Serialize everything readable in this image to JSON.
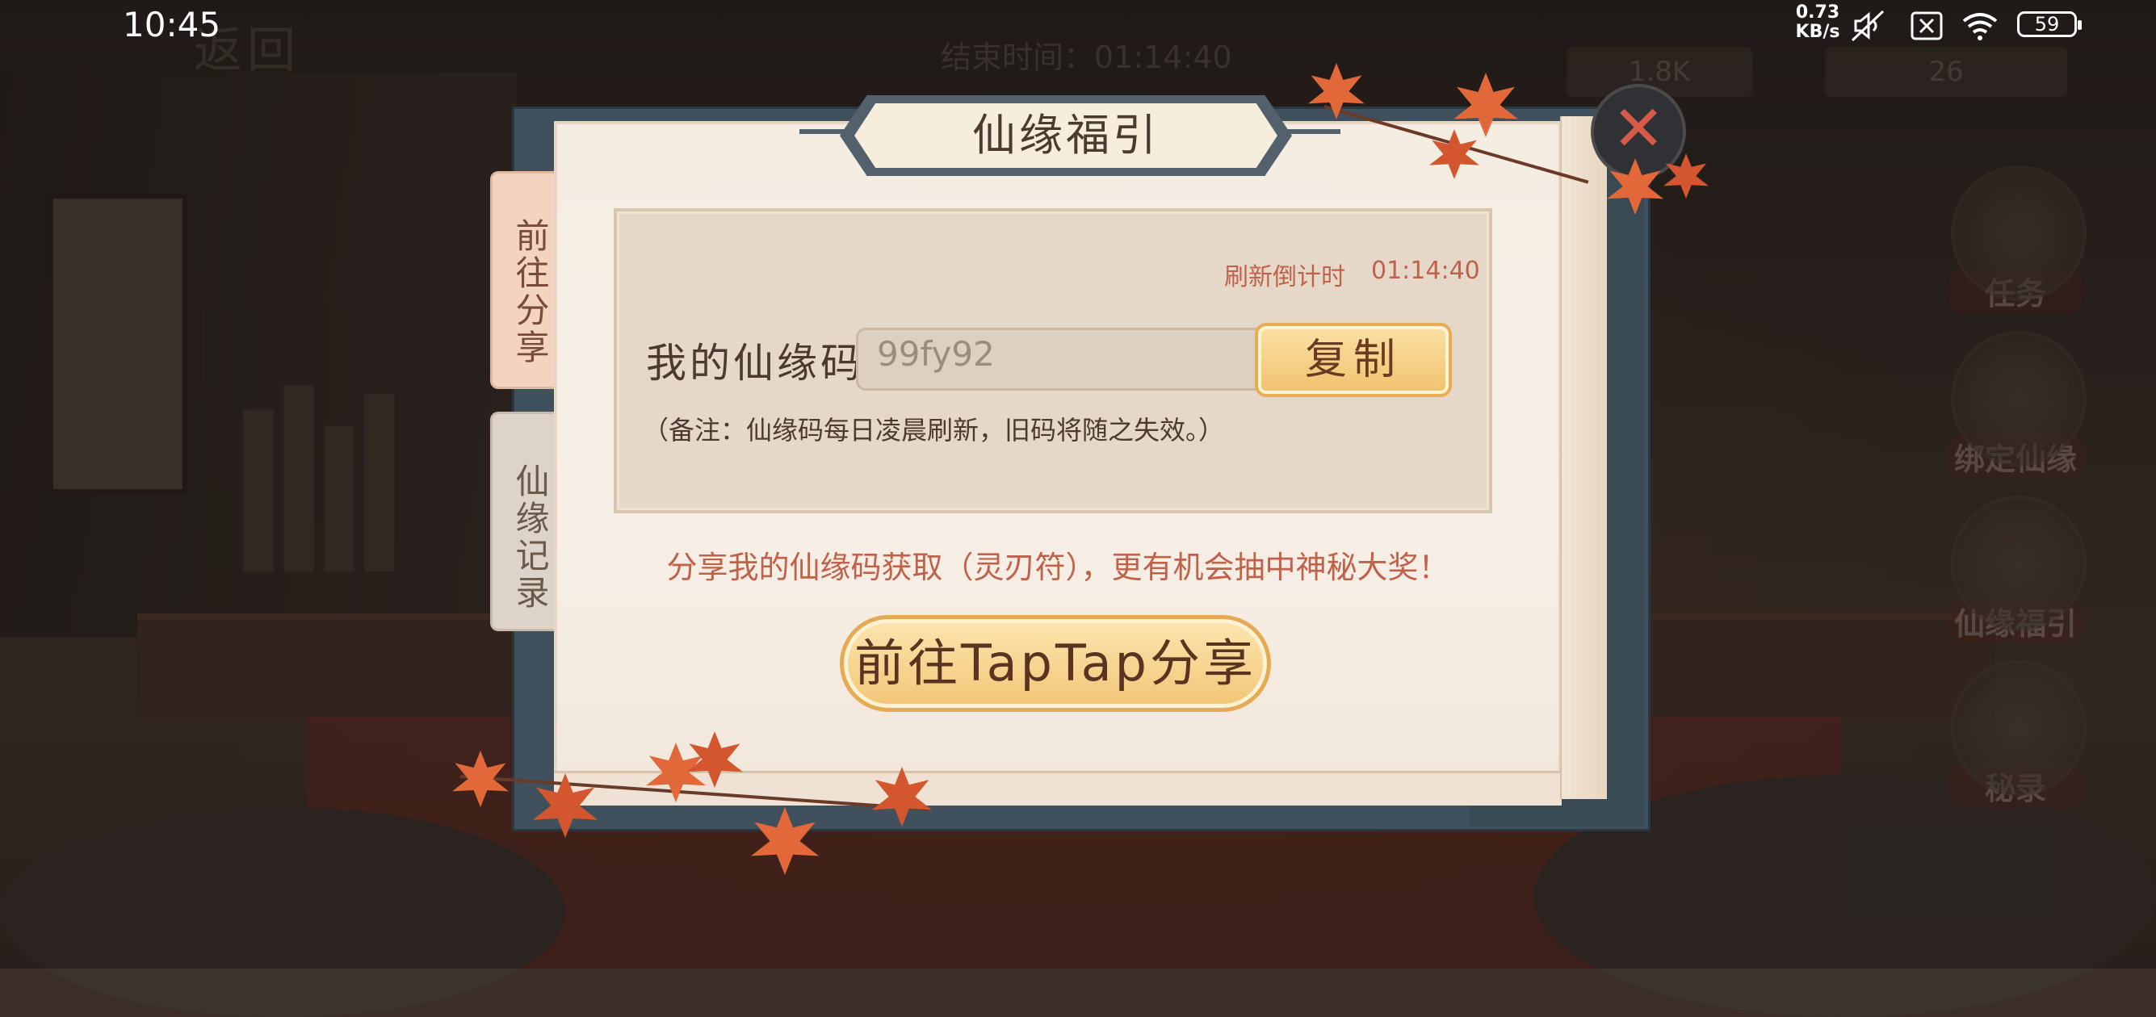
{
  "status_bar": {
    "time": "10:45",
    "net_speed_value": "0.73",
    "net_speed_unit": "KB/s",
    "battery": "59",
    "icons": [
      "mute-icon",
      "no-sim-icon",
      "wifi-icon",
      "battery-icon"
    ]
  },
  "hud": {
    "back_label": "返回",
    "end_time": "结束时间：01:14:40",
    "resource_1": "1.8K",
    "resource_2": "26"
  },
  "side_menu": [
    {
      "label": "任务",
      "icon": "scroll-icon"
    },
    {
      "label": "绑定仙缘",
      "icon": "bind-icon"
    },
    {
      "label": "仙缘福引",
      "icon": "scroll-roll-icon"
    },
    {
      "label": "秘录",
      "icon": "book-icon"
    }
  ],
  "dialog": {
    "title": "仙缘福引",
    "close_icon": "close-icon",
    "tabs": [
      {
        "label": "前往分享",
        "active": true
      },
      {
        "label": "仙缘记录",
        "active": false
      }
    ],
    "refresh_label": "刷新倒计时",
    "refresh_time": "01:14:40",
    "my_code_label": "我的仙缘码",
    "code_value": "99fy92",
    "copy_label": "复制",
    "note": "（备注：仙缘码每日凌晨刷新，旧码将随之失效。）",
    "share_hint": "分享我的仙缘码获取（灵刃符），更有机会抽中神秘大奖！",
    "share_button": "前往TapTap分享"
  },
  "colors": {
    "accent_text": "#c0614a",
    "button_gold": "#f0c26c",
    "frame_slate": "#53616c"
  }
}
